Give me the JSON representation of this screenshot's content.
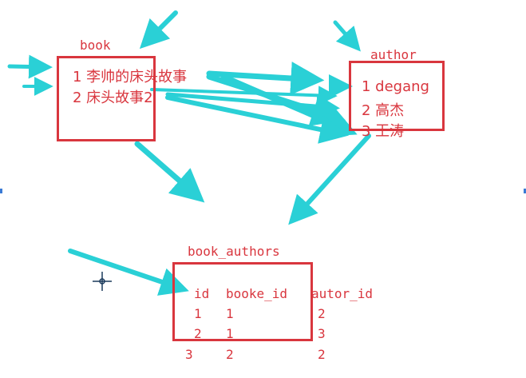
{
  "tables": {
    "book": {
      "title": "book",
      "rows": [
        "1 李帅的床头故事",
        "2 床头故事2"
      ]
    },
    "author": {
      "title": "author",
      "rows": [
        "1 degang",
        "2 高杰",
        "3 王涛"
      ]
    },
    "book_authors": {
      "title": "book_authors",
      "headers": [
        "id",
        "booke_id",
        "autor_id"
      ],
      "rows": [
        [
          "1",
          "1",
          "2"
        ],
        [
          "2",
          "1",
          "3"
        ],
        [
          "3",
          "2",
          "2"
        ]
      ]
    }
  },
  "colors": {
    "ink": "#d9363e",
    "arrow": "#2ad0d6"
  }
}
